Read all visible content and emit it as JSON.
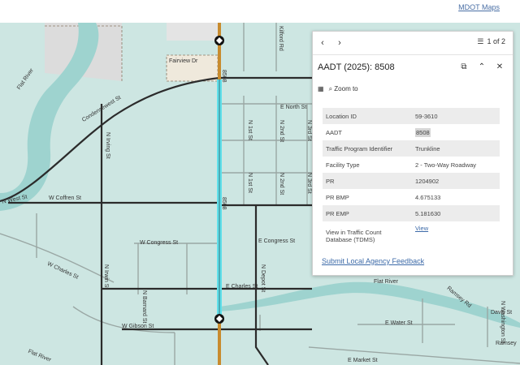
{
  "header": {
    "maps_link": "MDOT Maps"
  },
  "map": {
    "labels": {
      "fairview": "Fairview Dr",
      "kilfordrd": "Kilford Rd",
      "flatriver_nw": "Flat River",
      "condensewest": "Condensewest St",
      "nirving": "N Irving St",
      "wcoffren": "W Coffren St",
      "nwest": "N West St",
      "route_a": "8508",
      "route_b": "8508",
      "enorth": "E North St",
      "n1st": "N 1st St",
      "n2nd": "N 2nd St",
      "n3rd": "N 3rd St",
      "econgress": "E Congress St",
      "wcongress": "W Congress St",
      "wcharles": "W Charles St",
      "nbarnard": "N Barnard St",
      "nlrwin": "N Irwin St",
      "echarles": "E Charles St",
      "ndepot": "N Depot St",
      "wgibson": "W Gibson St",
      "flatriver_s": "Flat River",
      "flatriver_sw": "Flat River",
      "ramsey_rd": "Ramsey Rd",
      "davis": "Davis St",
      "ewater": "E Water St",
      "emarket": "E Market St",
      "ramsey": "Ramsey",
      "nwashington": "N Washington St"
    }
  },
  "popup": {
    "pager": "1 of 2",
    "title": "AADT (2025): 8508",
    "zoom_label": "Zoom to",
    "attributes": [
      {
        "key": "Location ID",
        "value": "59-3610"
      },
      {
        "key": "AADT",
        "value": "8508"
      },
      {
        "key": "Traffic Program Identifier",
        "value": "Trunkline"
      },
      {
        "key": "Facility Type",
        "value": "2 - Two-Way Roadway"
      },
      {
        "key": "PR",
        "value": "1204902"
      },
      {
        "key": "PR BMP",
        "value": "4.675133"
      },
      {
        "key": "PR EMP",
        "value": "5.181630"
      },
      {
        "key": "View in Traffic Count Database (TDMS)",
        "value": "View"
      }
    ],
    "feedback_link": "Submit Local Agency Feedback"
  }
}
